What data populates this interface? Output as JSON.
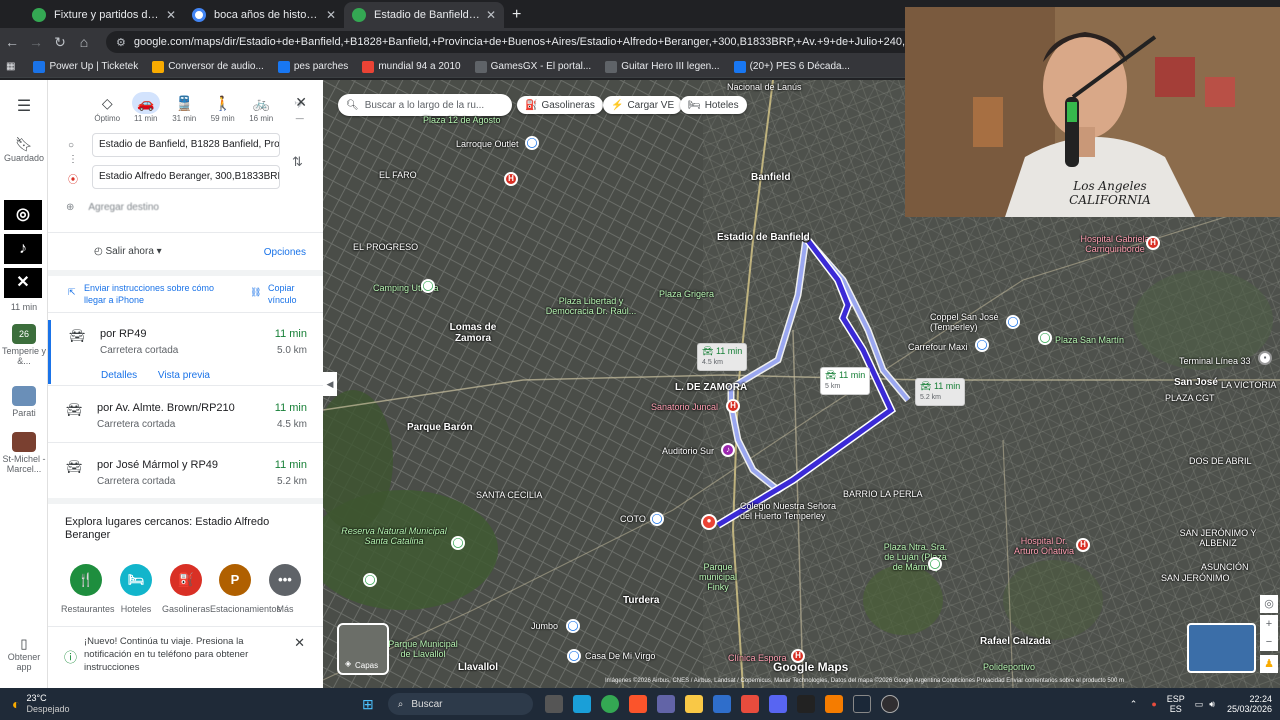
{
  "tabs": [
    {
      "title": "Fixture y partidos de mañana e",
      "color": "#34a853"
    },
    {
      "title": "boca años de historia - Buscar",
      "color": "#ffffff"
    },
    {
      "title": "Estadio de Banfield a Estadio A",
      "color": "#34a853"
    }
  ],
  "address": {
    "url": "google.com/maps/dir/Estadio+de+Banfield,+B1828+Banfield,+Provincia+de+Buenos+Aires/Estadio+Alfredo+Beranger,+300,B1833BRP,+Av.+9+de+Julio+240,+B1833BRP+Turdera,+Prov"
  },
  "bookmarks": [
    {
      "label": "Power Up | Ticketek",
      "color": "#1a73e8"
    },
    {
      "label": "Conversor de audio...",
      "color": "#f9ab00"
    },
    {
      "label": "pes parches",
      "color": "#1877f2"
    },
    {
      "label": "mundial 94 a 2010",
      "color": "#ea4335"
    },
    {
      "label": "GamesGX - El portal...",
      "color": "#5f6368"
    },
    {
      "label": "Guitar Hero III legen...",
      "color": "#5f6368"
    },
    {
      "label": "(20+) PES 6 Década...",
      "color": "#1877f2"
    }
  ],
  "rail": {
    "saved": "Guardado",
    "time": "11 min",
    "temp_label": "Temperie y &...",
    "temp_num": "26",
    "parati": "Parati",
    "stmichel": "St-Michel - Marcel...",
    "obtener": "Obtener app"
  },
  "modes": [
    {
      "label": "Óptimo",
      "icon": "◇"
    },
    {
      "label": "11 min",
      "icon": "🚗"
    },
    {
      "label": "31 min",
      "icon": "🚆"
    },
    {
      "label": "59 min",
      "icon": "🚶"
    },
    {
      "label": "16 min",
      "icon": "🚲"
    },
    {
      "label": "—",
      "icon": "✈"
    }
  ],
  "directions": {
    "origin": "Estadio de Banfield, B1828 Banfield, Prov",
    "destination": "Estadio Alfredo Beranger, 300,B1833BRP",
    "add_stop": "Agregar destino",
    "depart": "Salir ahora",
    "options": "Opciones",
    "send_phone": "Enviar instrucciones sobre cómo llegar a iPhone",
    "copy_link": "Copiar vínculo"
  },
  "routes": [
    {
      "name": "por RP49",
      "sub": "Carretera cortada",
      "time": "11 min",
      "dist": "5.0 km"
    },
    {
      "name": "por Av. Almte. Brown/RP210",
      "sub": "Carretera cortada",
      "time": "11 min",
      "dist": "4.5 km"
    },
    {
      "name": "por José Mármol y RP49",
      "sub": "Carretera cortada",
      "time": "11 min",
      "dist": "5.2 km"
    }
  ],
  "route_links": {
    "details": "Detalles",
    "preview": "Vista previa"
  },
  "explore": {
    "title": "Explora lugares cercanos: Estadio Alfredo Beranger",
    "items": [
      {
        "label": "Restaurantes",
        "icon": "🍴",
        "color": "#1e8e3e"
      },
      {
        "label": "Hoteles",
        "icon": "🛏",
        "color": "#12b5cb"
      },
      {
        "label": "Gasolineras",
        "icon": "⛽",
        "color": "#d93025"
      },
      {
        "label": "Estacionamientos",
        "icon": "P",
        "color": "#b06000"
      },
      {
        "label": "Más",
        "icon": "•••",
        "color": "#5f6368"
      }
    ]
  },
  "notification": {
    "text": "¡Nuevo! Continúa tu viaje. Presiona la notificación en tu teléfono para obtener instrucciones"
  },
  "map": {
    "search_placeholder": "Buscar a lo largo de la ru...",
    "chips": [
      "Gasolineras",
      "Cargar VE",
      "Hoteles"
    ],
    "labels": {
      "banfield": "Banfield",
      "estadio_banfield": "Estadio de Banfield",
      "lomas": "Lomas de Zamora",
      "parque_baron": "Parque Barón",
      "santa_cecilia": "SANTA CECILIA",
      "turdera": "Turdera",
      "llavallol": "Llavallol",
      "el_faro": "EL FARO",
      "el_progreso": "EL PROGRESO",
      "larroque": "Larroque Outlet",
      "camping": "Camping Uthgra",
      "plaza_libertad": "Plaza Libertad y Democracia Dr. Raúl...",
      "plaza_grigera": "Plaza Grigera",
      "sanatorio": "Sanatorio Juncal",
      "auditorio": "Auditorio Sur",
      "colegio": "Colegio Nuestra Señora del Huerto Temperley",
      "barrio_perla": "BARRIO LA PERLA",
      "coppel": "Coppel San José (Temperley)",
      "carrefour": "Carrefour Maxi",
      "plaza_sanmartin": "Plaza San Martín",
      "hospital_gabriela": "Hospital Gabriela Carriquiriborde",
      "terminal": "Terminal Línea 33",
      "san_jose": "San José",
      "plaza_cgt": "PLAZA CGT",
      "la_victoria": "LA VICTORIA",
      "dos_abril": "DOS DE ABRIL",
      "hospital_oñativia": "Hospital Dr. Arturo Oñativia",
      "plaza_nira": "Plaza Ntra. Sra. de Luján (Plaza de Mármol)",
      "san_jeronimo_albenz": "SAN JERÓNIMO Y ALBENIZ",
      "asuncion": "ASUNCIÓN",
      "san_jeronimo": "SAN JERÓNIMO",
      "rafael_calzada": "Rafael Calzada",
      "reserva": "Reserva Natural Municipal Santa Catalina",
      "parque_finky": "Parque municipal Finky",
      "coto": "COTO",
      "jumbo": "Jumbo",
      "casa_virgo": "Casa De Mi Virgo",
      "clinica": "Clínica Espora",
      "parque_llavallol": "Parque Municipal de Llavallol",
      "plaza_agosto": "Plaza 12 de Agosto",
      "nacional_lanus": "Nacional de Lanús",
      "l_de_zamora": "L. DE ZAMORA",
      "polideportivo": "Polideportivo",
      "google_maps": "Google Maps",
      "capas": "Capas"
    },
    "time_boxes": [
      {
        "time": "11 min",
        "dist": "4.5 km"
      },
      {
        "time": "11 min",
        "dist": "5 km"
      },
      {
        "time": "11 min",
        "dist": "5.2 km"
      }
    ],
    "attribution": "Imágenes ©2026 Airbus, CNES / Airbus, Landsat / Copernicus, Maxar Technologies, Datos del mapa ©2026 Google   Argentina   Condiciones   Privacidad   Enviar comentarios sobre el producto   500 m"
  },
  "webcam": {
    "shirt_text": "Los Angeles CALIFORNIA"
  },
  "taskbar": {
    "weather_temp": "23°C",
    "weather_desc": "Despejado",
    "search": "Buscar",
    "lang": "ESP",
    "lang2": "ES",
    "time": "22:24",
    "date": "25/03/2026"
  }
}
